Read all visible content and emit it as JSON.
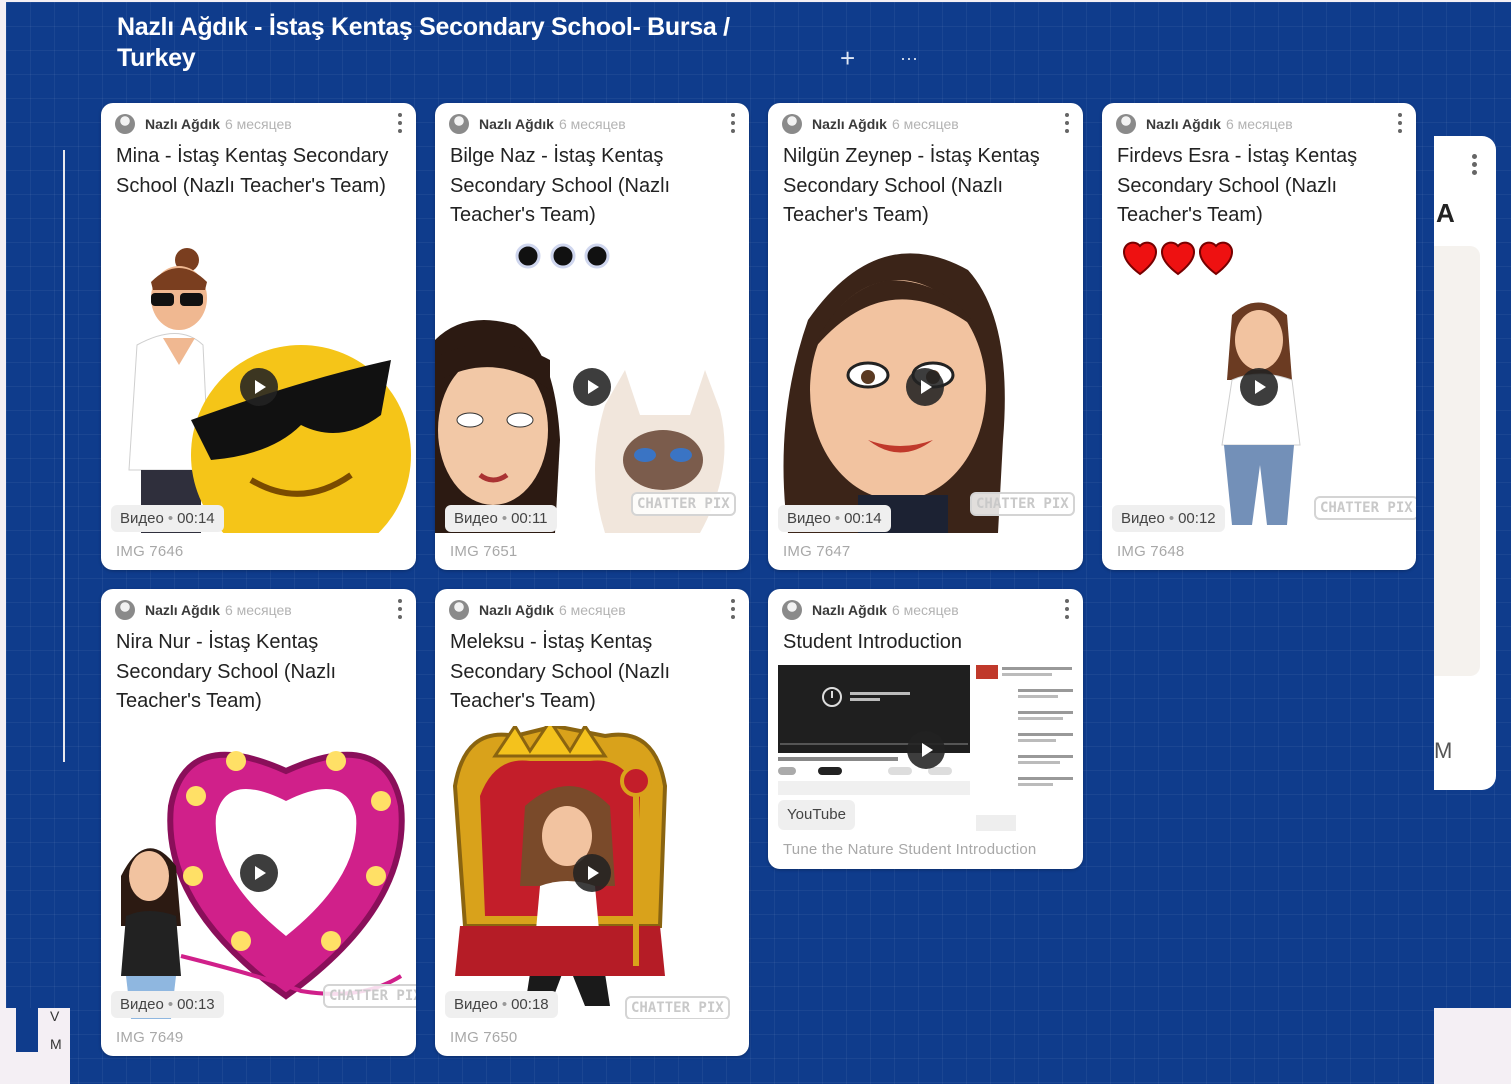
{
  "section": {
    "title": "Nazlı Ağdık - İstaş Kentaş Secondary School- Bursa / Turkey",
    "add_label": "+",
    "more_label": "···"
  },
  "cards": [
    {
      "author": "Nazlı Ağdık",
      "age": "6 месяцев",
      "title": "Mina - İstaş Kentaş Secondary School (Nazlı Teacher's Team)",
      "badge_type": "Видео",
      "badge_sep": "•",
      "duration": "00:14",
      "caption": "IMG 7646"
    },
    {
      "author": "Nazlı Ağdık",
      "age": "6 месяцев",
      "title": "Bilge Naz - İstaş Kentaş Secondary School (Nazlı Teacher's Team)",
      "badge_type": "Видео",
      "badge_sep": "•",
      "duration": "00:11",
      "caption": "IMG 7651"
    },
    {
      "author": "Nazlı Ağdık",
      "age": "6 месяцев",
      "title": "Nilgün Zeynep - İstaş Kentaş Secondary School (Nazlı Teacher's Team)",
      "badge_type": "Видео",
      "badge_sep": "•",
      "duration": "00:14",
      "caption": "IMG 7647"
    },
    {
      "author": "Nazlı Ağdık",
      "age": "6 месяцев",
      "title": "Firdevs Esra - İstaş Kentaş Secondary School (Nazlı Teacher's Team)",
      "badge_type": "Видео",
      "badge_sep": "•",
      "duration": "00:12",
      "caption": "IMG 7648"
    },
    {
      "author": "Nazlı Ağdık",
      "age": "6 месяцев",
      "title": "Nira Nur - İstaş Kentaş Secondary School (Nazlı Teacher's Team)",
      "badge_type": "Видео",
      "badge_sep": "•",
      "duration": "00:13",
      "caption": "IMG 7649"
    },
    {
      "author": "Nazlı Ağdık",
      "age": "6 месяцев",
      "title": "Meleksu - İstaş Kentaş Secondary School (Nazlı Teacher's Team)",
      "badge_type": "Видео",
      "badge_sep": "•",
      "duration": "00:18",
      "caption": "IMG 7650"
    },
    {
      "author": "Nazlı Ağdık",
      "age": "6 месяцев",
      "title": "Student Introduction",
      "badge_type": "YouTube",
      "caption": "Tune the Nature Student Introduction"
    }
  ],
  "watermark_text": "CHATTER PIX",
  "partial_column": {
    "letter_top": "A",
    "letter_bottom": "M"
  },
  "offscreen": {
    "line1": "V",
    "line2": "M"
  },
  "icons": {
    "avatar": "avatar-icon",
    "more": "more-vertical-icon",
    "play": "play-icon",
    "add": "plus-icon",
    "options": "more-horizontal-icon"
  },
  "colors": {
    "board_background": "#0f3c8c",
    "card_background": "#ffffff",
    "title_text": "#ffffff"
  }
}
